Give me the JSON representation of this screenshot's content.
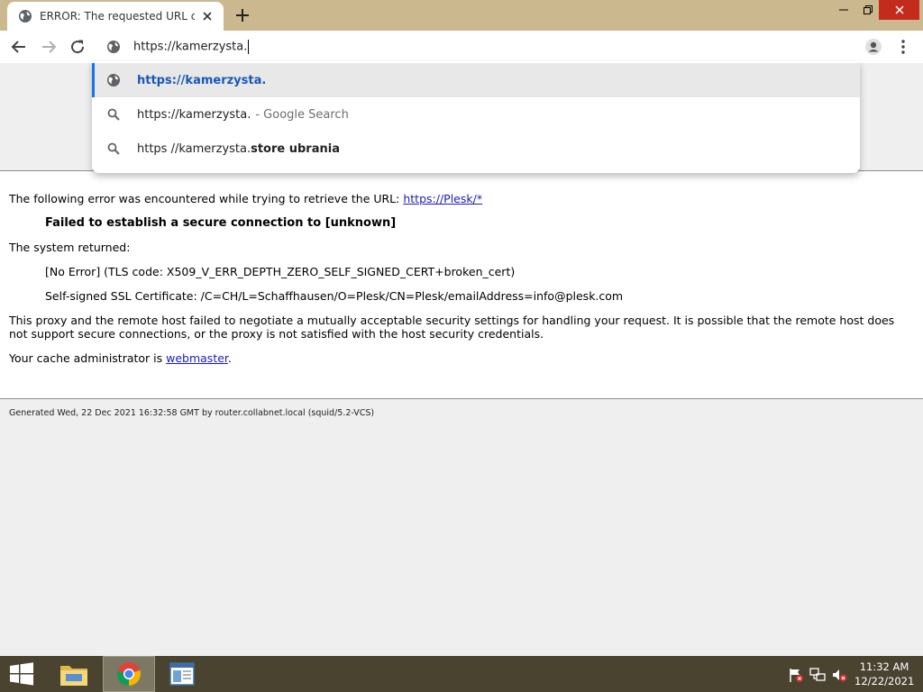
{
  "tab": {
    "title": "ERROR: The requested URL could not be retrieved"
  },
  "window_controls": {
    "minimize": "—",
    "maximize": "❐",
    "close": "✕"
  },
  "omnibox": {
    "value": "https://kamerzysta."
  },
  "suggestions": [
    {
      "main": "https://kamerzysta.",
      "hint": ""
    },
    {
      "main": "https://kamerzysta.",
      "hint": "- Google Search"
    },
    {
      "prefix": "https //kamerzysta.",
      "bold": "store ubrania"
    }
  ],
  "page": {
    "intro": "The following error was encountered while trying to retrieve the URL: ",
    "intro_link": "https://Plesk/*",
    "headline": "Failed to establish a secure connection to [unknown]",
    "system_returned": "The system returned:",
    "tls_line": "[No Error] (TLS code: X509_V_ERR_DEPTH_ZERO_SELF_SIGNED_CERT+broken_cert)",
    "cert_line": "Self-signed SSL Certificate: /C=CH/L=Schaffhausen/O=Plesk/CN=Plesk/emailAddress=info@plesk.com",
    "proxy_para": "This proxy and the remote host failed to negotiate a mutually acceptable security settings for handling your request. It is possible that the remote host does not support secure connections, or the proxy is not satisfied with the host security credentials.",
    "cache_admin_prefix": "Your cache administrator is ",
    "cache_admin_link": "webmaster",
    "cache_admin_suffix": ".",
    "footer": "Generated Wed, 22 Dec 2021 16:32:58 GMT by router.collabnet.local (squid/5.2-VCS)"
  },
  "taskbar": {
    "time": "11:32 AM",
    "date": "12/22/2021"
  },
  "colors": {
    "tabstrip": "#cbb88e",
    "taskbar": "#4a4330",
    "accent": "#1a73e8",
    "link": "#1b1bbd",
    "close_red": "#c42b1c"
  }
}
